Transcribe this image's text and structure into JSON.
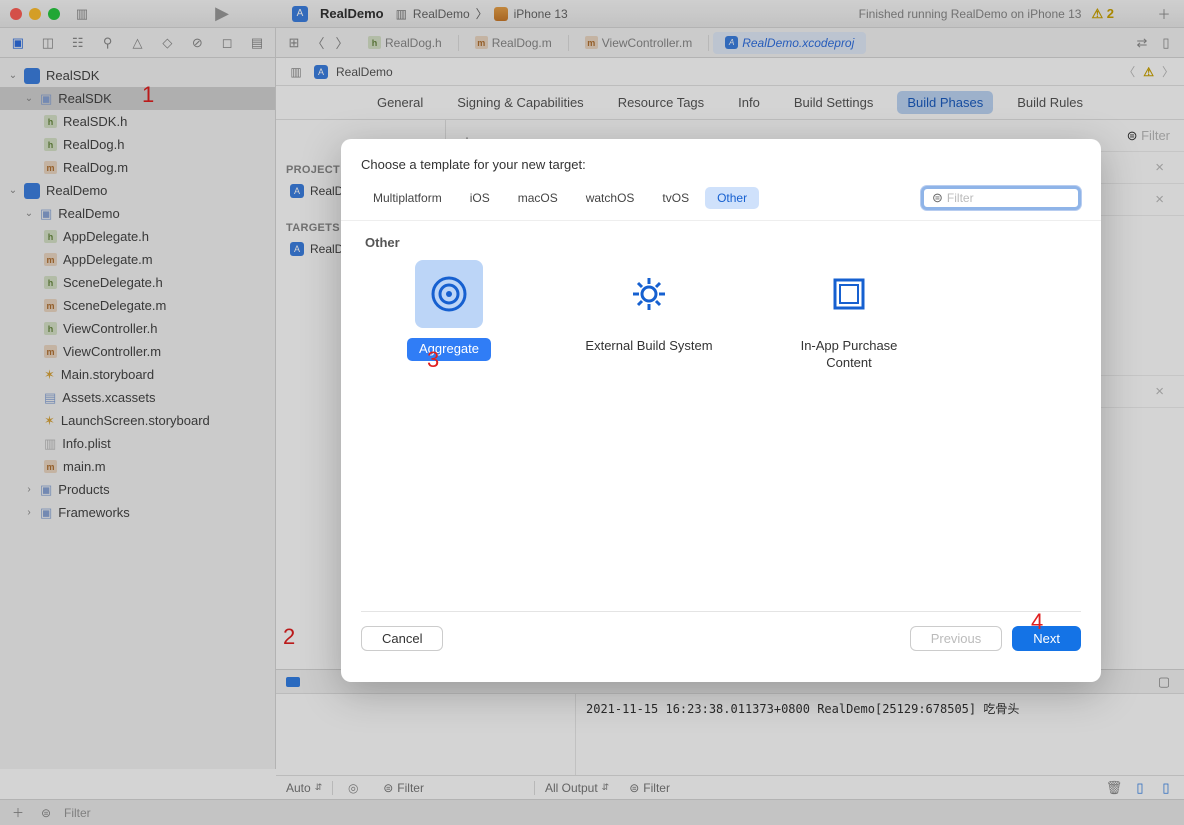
{
  "window": {
    "project_name": "RealDemo",
    "breadcrumb_scheme": "RealDemo",
    "breadcrumb_device": "iPhone 13",
    "status": "Finished running RealDemo on iPhone 13",
    "warn_count": "2"
  },
  "editor_tabs": [
    {
      "icon": "h",
      "label": "RealDog.h"
    },
    {
      "icon": "m",
      "label": "RealDog.m"
    },
    {
      "icon": "m",
      "label": "ViewController.m"
    },
    {
      "icon": "proj",
      "label": "RealDemo.xcodeproj",
      "active": true
    }
  ],
  "crumb": {
    "project": "RealDemo"
  },
  "settings_tabs": [
    "General",
    "Signing & Capabilities",
    "Resource Tags",
    "Info",
    "Build Settings",
    "Build Phases",
    "Build Rules"
  ],
  "settings_active": "Build Phases",
  "filter_placeholder": "Filter",
  "projects_header": "PROJECT",
  "projects": [
    "RealDemo"
  ],
  "targets_header": "TARGETS",
  "targets": [
    "RealDemo"
  ],
  "sidebar": {
    "root1": "RealSDK",
    "root1_folder": "RealSDK",
    "root1_files": [
      "RealSDK.h",
      "RealDog.h",
      "RealDog.m"
    ],
    "root2": "RealDemo",
    "root2_folder": "RealDemo",
    "root2_files": [
      "AppDelegate.h",
      "AppDelegate.m",
      "SceneDelegate.h",
      "SceneDelegate.m",
      "ViewController.h",
      "ViewController.m",
      "Main.storyboard",
      "Assets.xcassets",
      "LaunchScreen.storyboard",
      "Info.plist",
      "main.m"
    ],
    "root2_products": "Products",
    "root2_frameworks": "Frameworks"
  },
  "debug": {
    "auto": "Auto",
    "all_output": "All Output",
    "filter": "Filter",
    "log": "2021-11-15 16:23:38.011373+0800 RealDemo[25129:678505] 吃骨头"
  },
  "bottom": {
    "filter": "Filter"
  },
  "modal": {
    "title": "Choose a template for your new target:",
    "platforms": [
      "Multiplatform",
      "iOS",
      "macOS",
      "watchOS",
      "tvOS",
      "Other"
    ],
    "platform_active": "Other",
    "filter_placeholder": "Filter",
    "section": "Other",
    "templates": [
      {
        "id": "aggregate",
        "label": "Aggregate",
        "selected": true
      },
      {
        "id": "external",
        "label": "External Build System"
      },
      {
        "id": "iap",
        "label": "In-App Purchase Content"
      }
    ],
    "cancel": "Cancel",
    "previous": "Previous",
    "next": "Next"
  },
  "annotations": {
    "a1": "1",
    "a2": "2",
    "a3": "3",
    "a4": "4"
  }
}
